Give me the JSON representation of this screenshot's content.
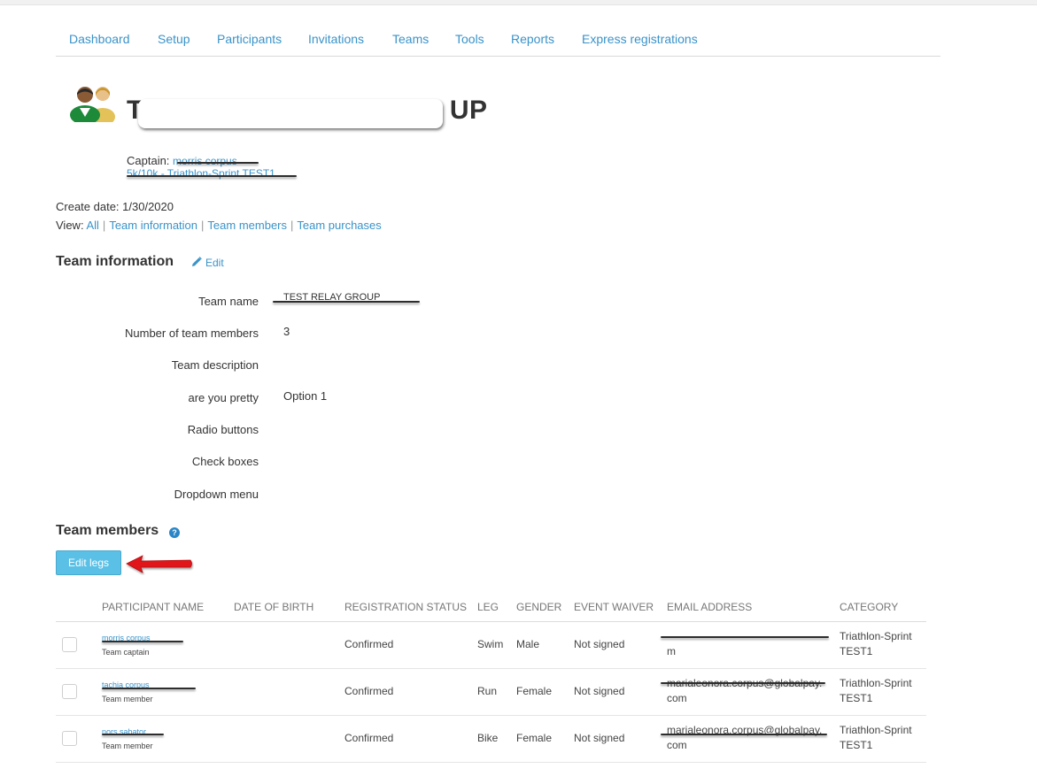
{
  "nav": {
    "items": [
      "Dashboard",
      "Setup",
      "Participants",
      "Invitations",
      "Teams",
      "Tools",
      "Reports",
      "Express registrations"
    ]
  },
  "header": {
    "title_start": "T",
    "title_end": "UP",
    "captain_label": "Captain:",
    "captain_name": "morris corpus",
    "event_link": "5k/10k - Triathlon-Sprint TEST1"
  },
  "meta": {
    "create_date": "Create date: 1/30/2020",
    "view_label": "View:",
    "view_links": [
      "All",
      "Team information",
      "Team members",
      "Team purchases"
    ]
  },
  "team_info": {
    "title": "Team information",
    "edit_label": "Edit",
    "fields": [
      {
        "label": "Team name",
        "value": "TEST RELAY GROUP"
      },
      {
        "label": "Number of team members",
        "value": "3"
      },
      {
        "label": "Team description",
        "value": ""
      },
      {
        "label": "are you pretty",
        "value": "Option 1"
      },
      {
        "label": "Radio buttons",
        "value": ""
      },
      {
        "label": "Check boxes",
        "value": ""
      },
      {
        "label": "Dropdown menu",
        "value": ""
      }
    ]
  },
  "team_members": {
    "title": "Team members",
    "help_glyph": "?",
    "edit_legs_label": "Edit legs",
    "columns": [
      "Participant name",
      "Date of birth",
      "Registration status",
      "Leg",
      "Gender",
      "Event waiver",
      "Email address",
      "Category"
    ],
    "rows": [
      {
        "name": "morris corpus",
        "role": "Team captain",
        "dob": "",
        "status": "Confirmed",
        "leg": "Swim",
        "gender": "Male",
        "waiver": "Not signed",
        "email_line1": "",
        "email_line2": "m",
        "category_line1": "Triathlon-Sprint",
        "category_line2": "TEST1"
      },
      {
        "name": "tachia corpus",
        "role": "Team member",
        "dob": "",
        "status": "Confirmed",
        "leg": "Run",
        "gender": "Female",
        "waiver": "Not signed",
        "email_line1": "marialeonora.corpus@globalpay.",
        "email_line2": "com",
        "category_line1": "Triathlon-Sprint",
        "category_line2": "TEST1"
      },
      {
        "name": "nors sabator",
        "role": "Team member",
        "dob": "",
        "status": "Confirmed",
        "leg": "Bike",
        "gender": "Female",
        "waiver": "Not signed",
        "email_line1": "marialeonora.corpus@globalpay.",
        "email_line2": "com",
        "category_line1": "Triathlon-Sprint",
        "category_line2": "TEST1"
      }
    ]
  },
  "colors": {
    "link": "#3a93c9",
    "button": "#5bc0e6",
    "arrow": "#e0161b"
  }
}
